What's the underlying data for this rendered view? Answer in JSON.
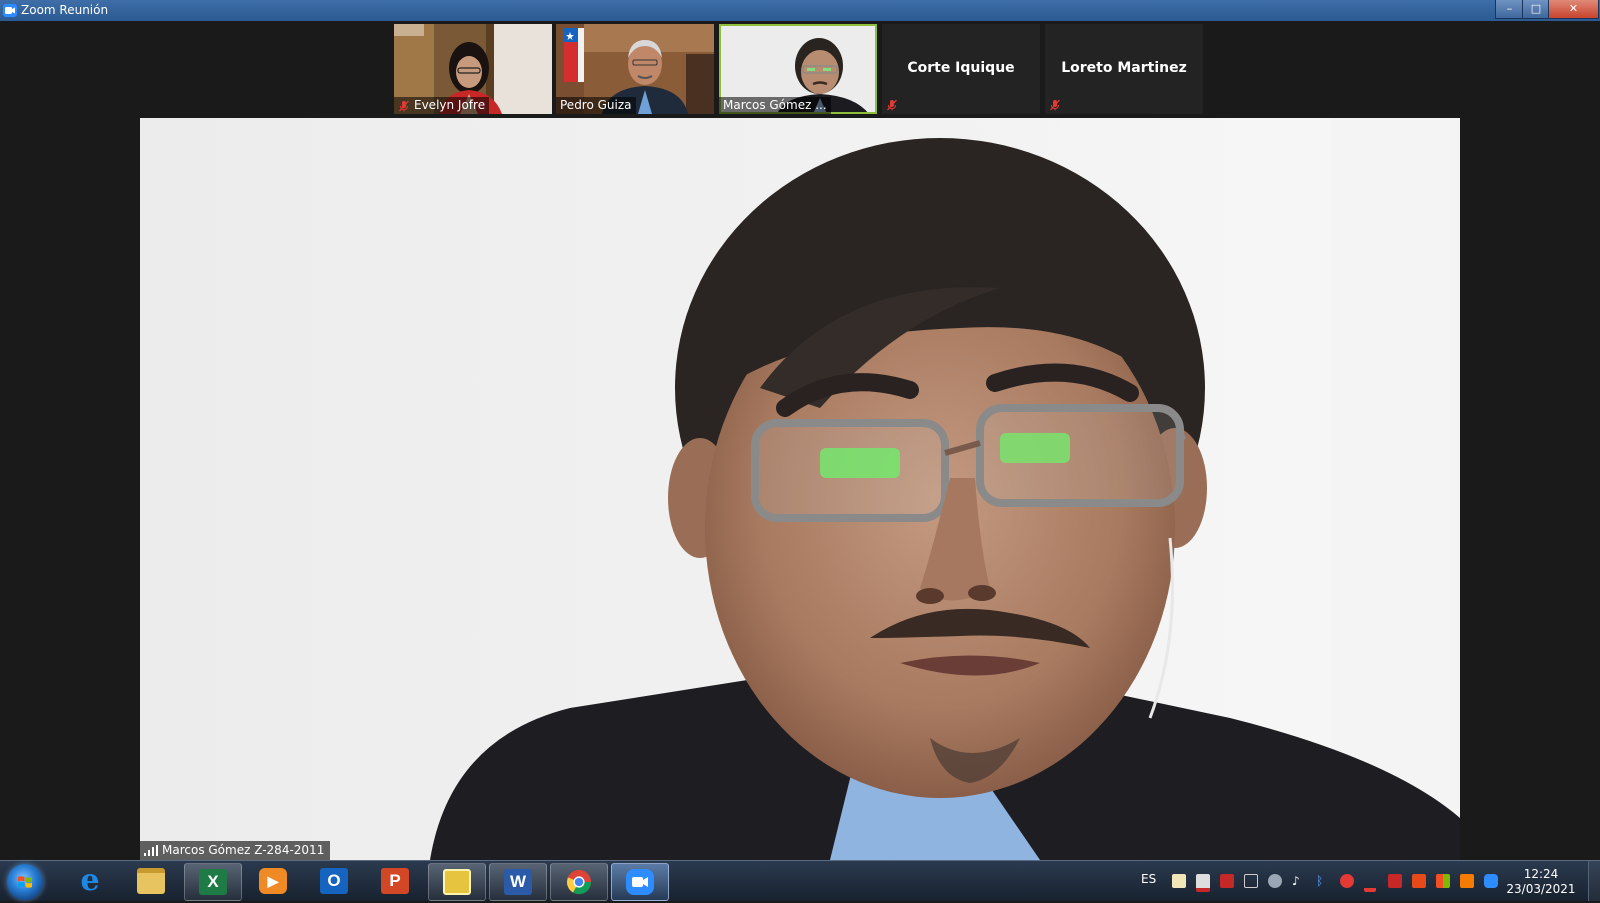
{
  "window": {
    "title": "Zoom Reunión",
    "controls": {
      "minimize": "–",
      "maximize": "□",
      "close": "✕"
    }
  },
  "participants": [
    {
      "name": "Evelyn Jofre",
      "muted": true,
      "video": true
    },
    {
      "name": "Pedro Guiza",
      "muted": false,
      "video": true
    },
    {
      "name": "Marcos Gómez ...",
      "muted": false,
      "video": true,
      "active_speaker": true
    },
    {
      "name": "Corte Iquique",
      "muted": true,
      "video": false
    },
    {
      "name": "Loreto Martinez",
      "muted": true,
      "video": false
    }
  ],
  "main_video": {
    "speaker_label": "Marcos Gómez Z-284-2011"
  },
  "taskbar": {
    "apps": [
      {
        "name": "internet-explorer",
        "glyph": "e",
        "color": "#1e88e5"
      },
      {
        "name": "file-explorer",
        "glyph": "",
        "color": "#e8c460"
      },
      {
        "name": "excel",
        "glyph": "X",
        "color": "#1e7b45"
      },
      {
        "name": "media-player",
        "glyph": "▶",
        "color": "#f08a24"
      },
      {
        "name": "outlook",
        "glyph": "O",
        "color": "#1565c0"
      },
      {
        "name": "powerpoint",
        "glyph": "P",
        "color": "#d24726"
      },
      {
        "name": "notes-app",
        "glyph": "",
        "color": "#e6c440"
      },
      {
        "name": "word",
        "glyph": "W",
        "color": "#2b5aa8"
      },
      {
        "name": "chrome",
        "glyph": "",
        "color": "#4caf50"
      },
      {
        "name": "zoom",
        "glyph": "",
        "color": "#2d8cff"
      }
    ],
    "language": "ES",
    "clock_time": "12:24",
    "clock_date": "23/03/2021",
    "colors": {
      "accent": "#2d8cff",
      "muted": "#e53935",
      "active_border": "#8fbf3a"
    }
  }
}
